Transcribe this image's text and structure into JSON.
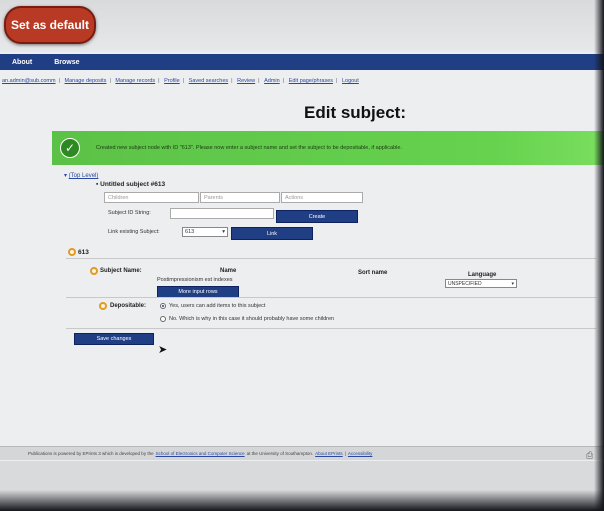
{
  "top_button": {
    "label": "Set as default"
  },
  "nav": {
    "tabs": [
      "About",
      "Browse"
    ]
  },
  "sublinks": [
    "an.admin@sub.comm",
    "Manage deposits",
    "Manage records",
    "Profile",
    "Saved searches",
    "Review",
    "Admin",
    "Edit page/phrases",
    "Logout"
  ],
  "page": {
    "title": "Edit subject:"
  },
  "message": {
    "text": "Created new subject node with ID \"613\". Please now enter a subject name and set the subject to be depositable, if applicable."
  },
  "tree": {
    "top_level_link": "(Top Level)",
    "untitled": "Untitled subject #613"
  },
  "children_table": {
    "headers": [
      "Children",
      "Parents",
      "Actions"
    ],
    "subject_id_label": "Subject ID String:",
    "create_label": "Create",
    "link_label": "Link existing Subject:",
    "link_select_value": "613",
    "link_button": "Link"
  },
  "section": {
    "id": "613"
  },
  "subject_fields": {
    "subject_name_label": "Subject Name:",
    "col_name": "Name",
    "col_sort": "Sort name",
    "col_language": "Language",
    "name_value": "Postimpressionism est indexes",
    "language_value": "UNSPECIFIED",
    "more_rows_button": "More input rows"
  },
  "depositable": {
    "label": "Depositable:",
    "yes_text": "Yes, users can add items to this subject",
    "no_text": "No. Which is why in this case it should probably have some children"
  },
  "save_button": "Save changes",
  "footer": {
    "text": "Publications is powered by EPrints 3 which is developed by the",
    "link1": "School of Electronics and Computer Science",
    "text2": "at the University of Southampton.",
    "link2": "About EPrints",
    "link3": "Accessibility"
  },
  "colors": {
    "nav": "#1f3e84",
    "success": "#5cc247",
    "accent_button": "#b83a24"
  }
}
